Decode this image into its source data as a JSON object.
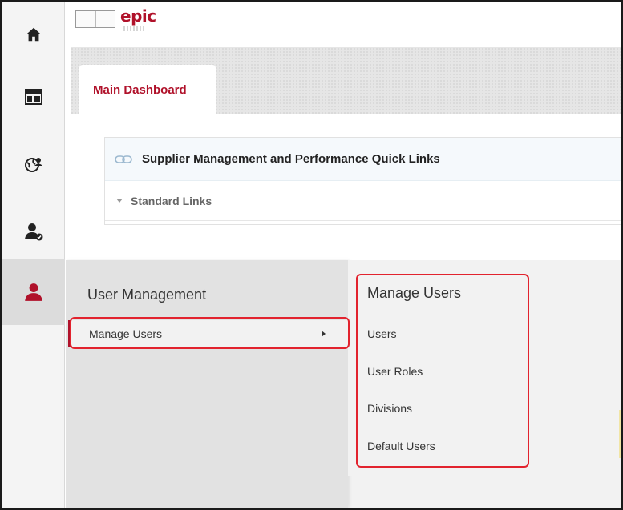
{
  "topbar": {
    "logo_text": "epic"
  },
  "tabs": [
    {
      "label": "Main Dashboard",
      "active": true
    }
  ],
  "quick_links": {
    "title": "Supplier Management and Performance Quick Links",
    "section_label": "Standard Links"
  },
  "rail": {
    "items": [
      "home-icon",
      "dashboard-icon",
      "globe-users-icon",
      "user-check-icon",
      "user-icon"
    ],
    "active_index": 4
  },
  "user_menu": {
    "heading": "User Management",
    "items": [
      {
        "label": "Manage Users",
        "has_submenu": true,
        "selected": true
      }
    ]
  },
  "submenu": {
    "heading": "Manage Users",
    "items": [
      "Users",
      "User Roles",
      "Divisions",
      "Default Users"
    ]
  },
  "colors": {
    "brand": "#b0112a",
    "highlight": "#e2232e"
  }
}
